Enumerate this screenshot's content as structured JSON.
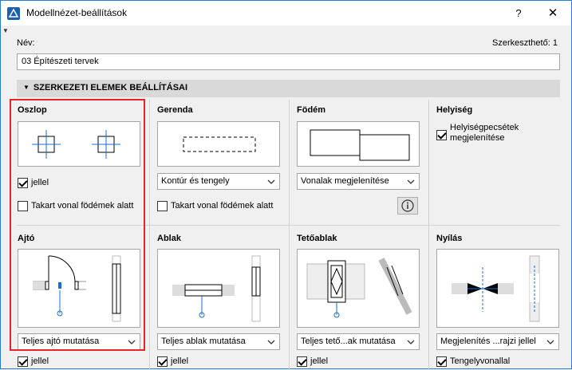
{
  "window": {
    "title": "Modellnézet-beállítások",
    "help": "?",
    "close": "✕"
  },
  "name_label": "Név:",
  "editable_label": "Szerkeszthető: 1",
  "name_value": "03 Építészeti tervek",
  "section_title": "SZERKEZETI ELEMEK BEÁLLÍTÁSAI",
  "cells": {
    "oszlop": {
      "title": "Oszlop",
      "check1": "jellel",
      "check2": "Takart vonal födémek alatt"
    },
    "gerenda": {
      "title": "Gerenda",
      "dropdown": "Kontúr és tengely",
      "check1": "Takart vonal födémek alatt"
    },
    "fodem": {
      "title": "Födém",
      "dropdown": "Vonalak megjelenítése"
    },
    "helyiseg": {
      "title": "Helyiség",
      "check1": "Helyiségpecsétek megjelenítése"
    },
    "ajto": {
      "title": "Ajtó",
      "dropdown": "Teljes ajtó mutatása",
      "check1": "jellel"
    },
    "ablak": {
      "title": "Ablak",
      "dropdown": "Teljes ablak mutatása",
      "check1": "jellel"
    },
    "tetoablak": {
      "title": "Tetőablak",
      "dropdown": "Teljes tető...ak mutatása",
      "check1": "jellel"
    },
    "nyilas": {
      "title": "Nyílás",
      "dropdown": "Megjelenítés ...rajzi jellel",
      "check1": "Tengelyvonallal"
    }
  },
  "colors": {
    "highlight": "#e8262a",
    "accent_blue": "#1a6fd6",
    "section_bg": "#d9d9d9"
  }
}
